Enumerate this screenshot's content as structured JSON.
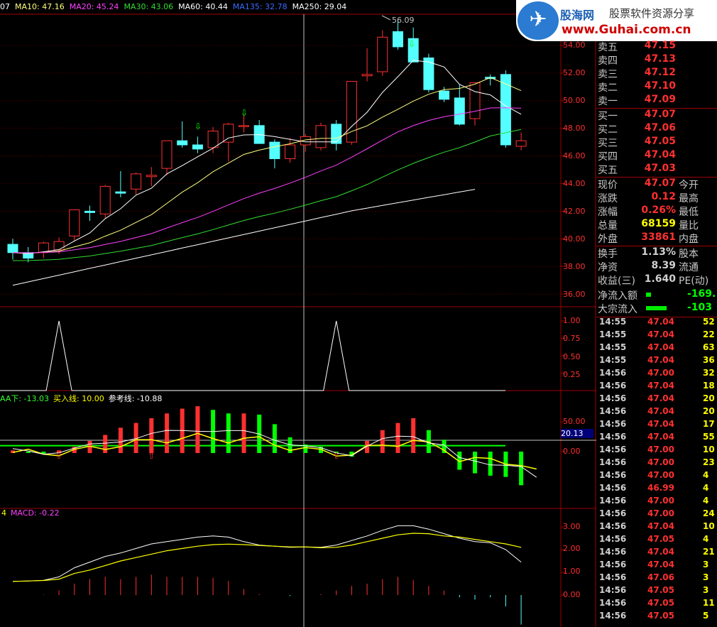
{
  "colors": {
    "up": "#ff3030",
    "down": "#54ffff",
    "ma5": "#ffffff",
    "ma10": "#ffff80",
    "ma20": "#ff40ff",
    "ma30": "#33dd33",
    "ma60": "#ffffff",
    "ma135": "#3a6bff",
    "ma250": "#ffffff",
    "grid": "#a00000",
    "green": "#00ff00",
    "yellow": "#ffff00"
  },
  "topbar": {
    "frag": "07",
    "ma10": "MA10: 47.16",
    "ma20": "MA20: 45.24",
    "ma30": "MA30: 43.06",
    "ma60": "MA60: 40.44",
    "ma135": "MA135: 32.78",
    "ma250": "MA250: 29.04"
  },
  "logo": {
    "brand": "股海网",
    "slogan": "股票软件资源分享",
    "url": "www.Guhai.com.cn"
  },
  "price_axis": [
    "54.00",
    "52.00",
    "50.00",
    "48.00",
    "46.00",
    "44.00",
    "42.00",
    "40.00",
    "38.00",
    "36.00"
  ],
  "peak_label": "56.09",
  "signal_axis": [
    "1.00",
    "0.75",
    "0.50",
    "0.25"
  ],
  "aa_panel": {
    "aa": "AA下: -13.03",
    "buy": "买入线: 10.00",
    "ref": "参考线: -10.88",
    "axis_top": "50.00",
    "axis_zero": "0.00",
    "crosshair_value": "20.13"
  },
  "macd_panel": {
    "frag": "4",
    "macd": "MACD: -0.22",
    "axis": [
      "3.00",
      "2.00",
      "1.00",
      "0.00"
    ]
  },
  "chart_data": [
    {
      "type": "candlestick",
      "name": "price",
      "ohlc": [
        [
          39.6,
          40.0,
          38.5,
          39.0
        ],
        [
          39.0,
          39.4,
          38.3,
          38.6
        ],
        [
          39.0,
          39.8,
          38.6,
          39.7
        ],
        [
          39.2,
          40.1,
          38.9,
          39.8
        ],
        [
          40.2,
          42.1,
          39.8,
          42.1
        ],
        [
          42.0,
          42.4,
          41.3,
          41.9
        ],
        [
          41.8,
          43.9,
          41.5,
          43.8
        ],
        [
          43.4,
          44.9,
          43.0,
          43.3
        ],
        [
          43.6,
          44.8,
          43.2,
          44.7
        ],
        [
          44.5,
          45.2,
          43.8,
          44.6
        ],
        [
          45.1,
          47.1,
          44.6,
          47.1
        ],
        [
          47.1,
          48.5,
          46.6,
          46.8
        ],
        [
          46.8,
          47.4,
          46.2,
          46.5
        ],
        [
          46.6,
          48.1,
          46.2,
          47.8
        ],
        [
          47.0,
          48.4,
          45.6,
          48.3
        ],
        [
          48.2,
          49.0,
          47.7,
          48.2
        ],
        [
          48.2,
          48.6,
          47.2,
          46.9
        ],
        [
          47.0,
          47.2,
          45.1,
          45.8
        ],
        [
          45.8,
          47.3,
          45.5,
          46.8
        ],
        [
          46.8,
          47.6,
          46.3,
          47.4
        ],
        [
          46.6,
          48.4,
          46.4,
          48.2
        ],
        [
          48.3,
          48.6,
          46.4,
          46.9
        ],
        [
          47.0,
          51.4,
          46.8,
          51.4
        ],
        [
          51.8,
          53.8,
          51.4,
          51.9
        ],
        [
          52.1,
          55.1,
          51.8,
          54.6
        ],
        [
          55.0,
          55.8,
          53.7,
          53.9
        ],
        [
          54.5,
          55.3,
          52.8,
          52.8
        ],
        [
          53.1,
          53.4,
          50.6,
          50.8
        ],
        [
          50.7,
          51.0,
          49.9,
          50.1
        ],
        [
          50.2,
          51.2,
          48.2,
          48.3
        ],
        [
          48.7,
          51.3,
          48.2,
          51.3
        ],
        [
          51.7,
          51.9,
          51.1,
          51.6
        ],
        [
          51.9,
          52.2,
          46.6,
          46.8
        ],
        [
          46.7,
          47.7,
          46.4,
          47.1
        ]
      ],
      "ma_series": [
        "MA5",
        "MA10",
        "MA20",
        "MA30",
        "MA60"
      ]
    },
    {
      "type": "line",
      "name": "signal",
      "ylim": [
        0,
        1.0
      ],
      "pulses_at_index": [
        3,
        21
      ]
    },
    {
      "type": "bar",
      "name": "AA",
      "series": [
        {
          "name": "AA下",
          "last": -13.03
        },
        {
          "name": "买入线",
          "value": 10.0
        },
        {
          "name": "参考线",
          "last": -10.88
        }
      ]
    },
    {
      "type": "line",
      "name": "MACD",
      "ylim": [
        -0.3,
        3.3
      ],
      "last": -0.22
    }
  ]
}
